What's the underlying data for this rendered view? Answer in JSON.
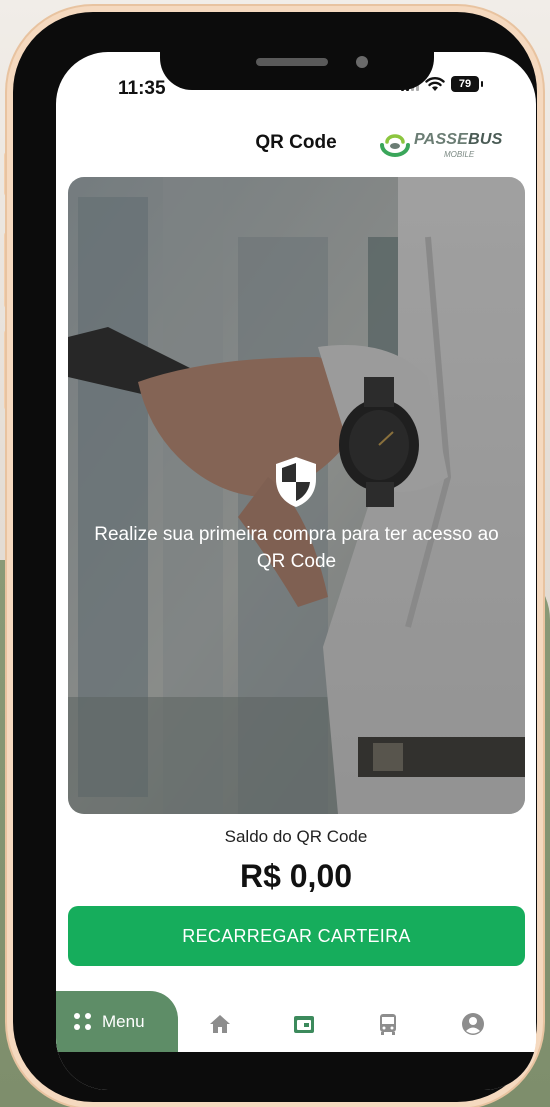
{
  "status_bar": {
    "time": "11:35",
    "battery": "79"
  },
  "header": {
    "title": "QR Code",
    "logo_text_a": "PASSE",
    "logo_text_b": "BUS",
    "logo_sub": "MOBILE"
  },
  "hero": {
    "message": "Realize sua primeira compra para ter acesso ao QR Code",
    "icon": "shield-icon"
  },
  "balance": {
    "label": "Saldo do QR Code",
    "value": "R$ 0,00"
  },
  "actions": {
    "recharge_label": "RECARREGAR CARTEIRA"
  },
  "bottom_nav": {
    "menu_label": "Menu",
    "items": [
      {
        "icon": "home-icon"
      },
      {
        "icon": "wallet-icon"
      },
      {
        "icon": "bus-icon"
      },
      {
        "icon": "profile-icon"
      }
    ]
  },
  "colors": {
    "accent": "#16ad5c",
    "menu_tab": "#5e8d67",
    "nav_active": "#3c8a5c",
    "nav_inactive": "#8d8d8d"
  }
}
